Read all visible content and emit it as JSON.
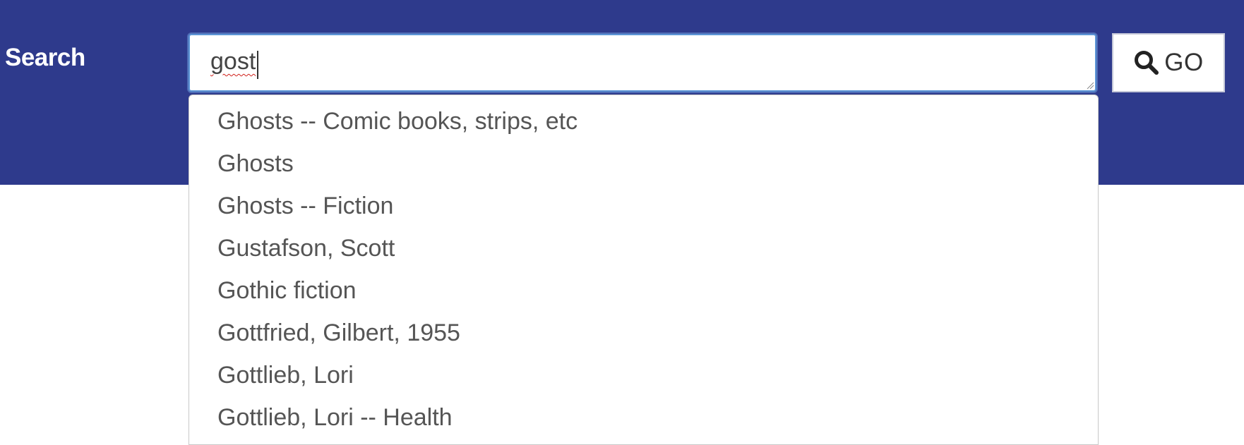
{
  "header": {
    "search_label": "Search",
    "band_color": "#2e3a8c"
  },
  "search": {
    "value": "gost",
    "spellcheck_flagged": true
  },
  "go_button": {
    "label": "GO",
    "icon": "search-icon"
  },
  "suggestions": [
    {
      "label": "Ghosts -- Comic books, strips, etc"
    },
    {
      "label": "Ghosts"
    },
    {
      "label": "Ghosts -- Fiction"
    },
    {
      "label": "Gustafson, Scott"
    },
    {
      "label": "Gothic fiction"
    },
    {
      "label": "Gottfried, Gilbert, 1955"
    },
    {
      "label": "Gottlieb, Lori"
    },
    {
      "label": "Gottlieb, Lori -- Health"
    }
  ]
}
